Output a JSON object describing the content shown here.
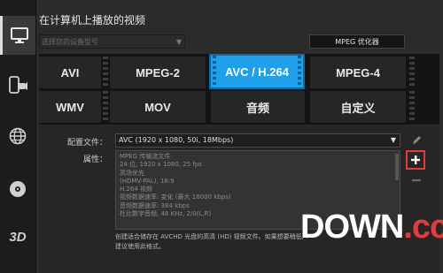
{
  "sidebar": {
    "items": [
      {
        "name": "computer-playback",
        "icon": "monitor-icon",
        "active": true
      },
      {
        "name": "device",
        "icon": "phone-camera-icon",
        "active": false
      },
      {
        "name": "web",
        "icon": "globe-icon",
        "active": false
      },
      {
        "name": "disc",
        "icon": "disc-icon",
        "active": false
      },
      {
        "name": "3d",
        "icon": "3d-icon",
        "active": false
      }
    ],
    "three_d_label": "3D"
  },
  "section_title": "在计算机上播放的视频",
  "device_select": {
    "value": "选择您的设备型号",
    "disabled": true
  },
  "mpeg_optimizer_button": "MPEG 优化器",
  "formats": [
    {
      "label": "AVI",
      "selected": false
    },
    {
      "label": "MPEG-2",
      "selected": false
    },
    {
      "label": "AVC / H.264",
      "selected": true
    },
    {
      "label": "MPEG-4",
      "selected": false
    },
    {
      "label": "WMV",
      "selected": false
    },
    {
      "label": "MOV",
      "selected": false
    },
    {
      "label": "音频",
      "selected": false
    },
    {
      "label": "自定义",
      "selected": false
    }
  ],
  "profile": {
    "label": "配置文件：",
    "value": "AVC (1920 x 1080, 50i, 18Mbps)"
  },
  "properties": {
    "label": "属性：",
    "lines": [
      "MPEG 传输流文件",
      "24 位, 1920 x 1080, 25 fps",
      "高场优先",
      "(HDMV-PAL), 16:9",
      "H.264 视频",
      "视频数据速率: 变化 (最大 18000 kbps)",
      "音频数据速率: 384 kbps",
      "杜比数字音频, 48 KHz, 2/0(L,R)"
    ]
  },
  "description": [
    "创建适合储存在 AVCHD 光盘的高清 (HD) 视频文件。如果想要稍低声",
    "建议使用此格式。"
  ],
  "tools": {
    "edit": "pencil-icon",
    "add": "plus-icon",
    "remove": "minus-icon"
  },
  "watermark": {
    "main": "DOWN",
    "suffix": ".cc"
  },
  "colors": {
    "accent": "#1fa0e8",
    "highlight": "#e23b3b"
  }
}
